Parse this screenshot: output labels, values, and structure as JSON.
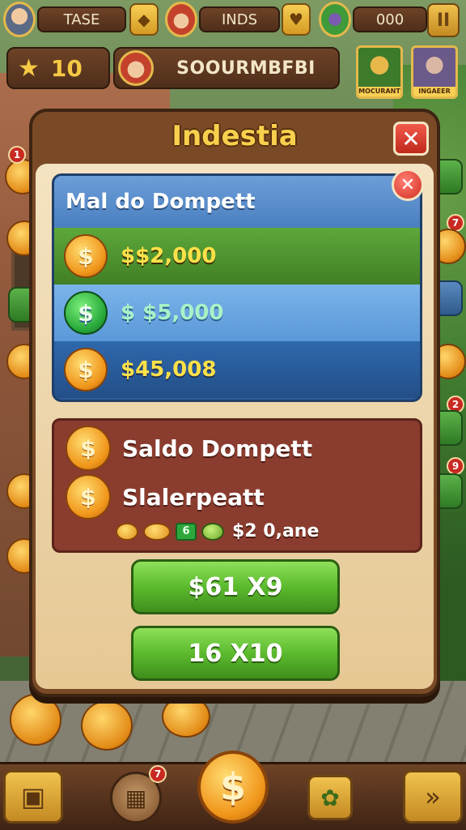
{
  "hud": {
    "slot1_label": "TASE",
    "slot2_label": "INDS",
    "slot3_value": "000",
    "pause_glyph": "II",
    "gem1_glyph": "◆",
    "gem2_glyph": "♥"
  },
  "player": {
    "stars_value": "10",
    "name": "SOOURMBFBI"
  },
  "characters": [
    {
      "caption": "MOCURANT"
    },
    {
      "caption": "INGAEER"
    }
  ],
  "dialog": {
    "title": "Indestia",
    "close_glyph": "✕",
    "list": {
      "header": "Mal do Dompett",
      "close_glyph": "✕",
      "rows": [
        {
          "coin": "$",
          "amount": "$$2,000"
        },
        {
          "coin": "$",
          "amount": "$ $5,000"
        },
        {
          "coin": "$",
          "amount": "$45,008"
        }
      ]
    },
    "wallet": {
      "line1": "Saldo Dompett",
      "line2": "Slalerpeatt",
      "bill_glyph": "6",
      "strip_amount": "$2 0,ane"
    },
    "buttons": {
      "primary": "$61 X9",
      "secondary": "16 X10"
    }
  },
  "badges": {
    "left_top": "1",
    "right_1": "7",
    "right_2": "2",
    "right_3": "9",
    "bottom_chest": "7"
  },
  "bottom_bar": {
    "center_coin": "$",
    "arrow_glyph": "»",
    "cards_glyph": "▣",
    "chest_glyph": "▦",
    "bug_glyph": "✿"
  },
  "colors": {
    "accent_gold": "#f8d04c",
    "panel_brown": "#7a4a26",
    "list_blue": "#2d5c97",
    "row_green": "#5da83b",
    "wallet_red": "#8a3c2e",
    "button_green": "#5cba2e",
    "close_red": "#c0281c"
  }
}
